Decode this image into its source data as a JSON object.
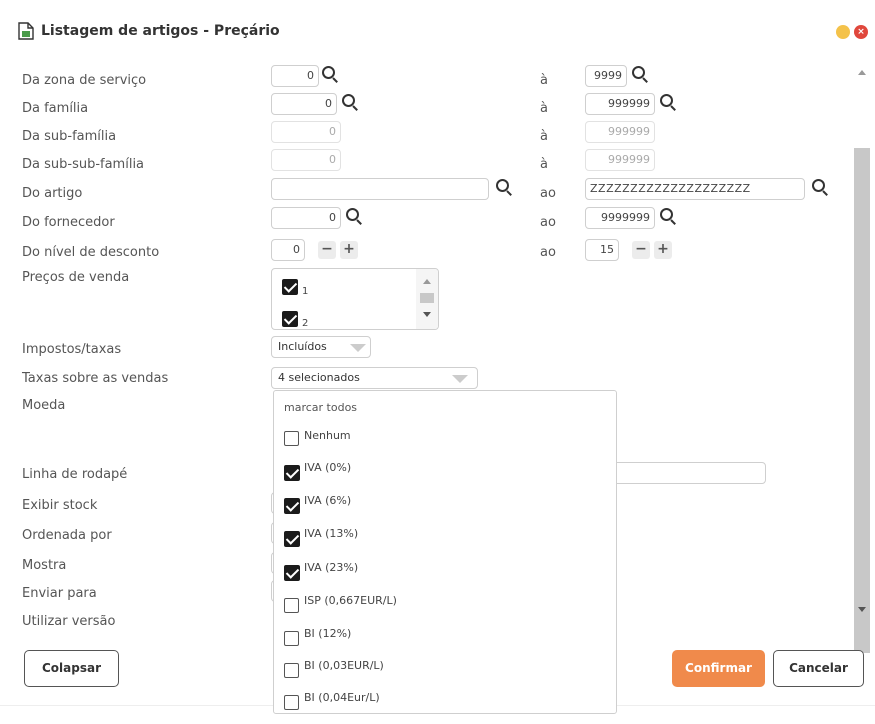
{
  "window": {
    "title": "Listagem de artigos - Preçário",
    "close_glyph": "×",
    "colors": {
      "minimize": "#f4c24a",
      "close": "#e0473c",
      "accent": "#f08a4b"
    }
  },
  "form": {
    "zona": {
      "label": "Da zona de serviço",
      "from": "0",
      "to_label": "à",
      "to": "9999"
    },
    "familia": {
      "label": "Da família",
      "from": "0",
      "to_label": "à",
      "to": "999999"
    },
    "subfamilia": {
      "label": "Da sub-família",
      "from": "0",
      "to_label": "à",
      "to": "999999"
    },
    "subsubfamilia": {
      "label": "Da sub-sub-família",
      "from": "0",
      "to_label": "à",
      "to": "999999"
    },
    "artigo": {
      "label": "Do artigo",
      "from": "",
      "to_label": "ao",
      "to": "ZZZZZZZZZZZZZZZZZZZZ"
    },
    "fornecedor": {
      "label": "Do fornecedor",
      "from": "0",
      "to_label": "ao",
      "to": "9999999"
    },
    "desconto": {
      "label": "Do nível de desconto",
      "from": "0",
      "to_label": "ao",
      "to": "15",
      "minus": "−",
      "plus": "+"
    },
    "precos": {
      "label": "Preços de venda",
      "items": [
        "1",
        "2"
      ]
    },
    "impostos": {
      "label": "Impostos/taxas",
      "value": "Incluídos"
    },
    "taxas": {
      "label": "Taxas sobre as vendas",
      "value": "4 selecionados"
    },
    "moeda": {
      "label": "Moeda"
    },
    "rodape": {
      "label": "Linha de rodapé"
    },
    "stock": {
      "label": "Exibir stock"
    },
    "ordenada": {
      "label": "Ordenada por"
    },
    "mostra": {
      "label": "Mostra"
    },
    "enviar": {
      "label": "Enviar para"
    },
    "versao": {
      "label": "Utilizar versão"
    }
  },
  "dropdown": {
    "header": "marcar todos",
    "items": [
      {
        "label": "Nenhum",
        "checked": false
      },
      {
        "label": "IVA (0%)",
        "checked": true
      },
      {
        "label": "IVA (6%)",
        "checked": true
      },
      {
        "label": "IVA (13%)",
        "checked": true
      },
      {
        "label": "IVA (23%)",
        "checked": true
      },
      {
        "label": "ISP (0,667EUR/L)",
        "checked": false
      },
      {
        "label": "BI (12%)",
        "checked": false
      },
      {
        "label": "BI (0,03EUR/L)",
        "checked": false
      },
      {
        "label": "BI (0,04Eur/L)",
        "checked": false
      }
    ]
  },
  "buttons": {
    "collapse": "Colapsar",
    "confirm": "Confirmar",
    "cancel": "Cancelar"
  }
}
